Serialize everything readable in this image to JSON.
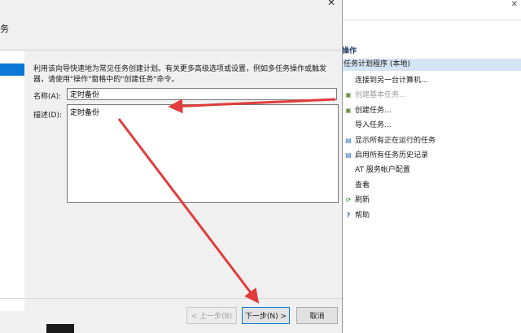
{
  "dialog": {
    "title_partial": "务",
    "close_glyph": "✕",
    "intro_line1": "利用该向导快速地为常见任务创建计划。有关更多高级选项或设置，例如多任务操作或触发",
    "intro_line2": "器，请使用\"操作\"窗格中的\"创建任务\"命令。",
    "name_label": "名称(A):",
    "name_value": "定时备份",
    "desc_label": "描述(D):",
    "desc_value": "定时备份",
    "buttons": {
      "back": "< 上一步(B)",
      "next": "下一步(N) >",
      "cancel": "取消"
    }
  },
  "actions_pane": {
    "close_glyph": "✕",
    "header": "操作",
    "section": "任务计划程序 (本地)",
    "items": [
      {
        "label": "连接到另一台计算机...",
        "icon": "none",
        "enabled": true
      },
      {
        "label": "创建基本任务...",
        "icon": "task-icon",
        "enabled": false
      },
      {
        "label": "创建任务...",
        "icon": "task-icon",
        "enabled": true
      },
      {
        "label": "导入任务...",
        "icon": "none",
        "enabled": true
      },
      {
        "label": "显示所有正在运行的任务",
        "icon": "list-icon",
        "enabled": true
      },
      {
        "label": "启用所有任务历史记录",
        "icon": "list-icon",
        "enabled": true
      },
      {
        "label": "AT 服务帐户配置",
        "icon": "none",
        "enabled": true
      },
      {
        "label": "查看",
        "icon": "none",
        "enabled": true
      },
      {
        "label": "刷新",
        "icon": "refresh-icon",
        "enabled": true
      },
      {
        "label": "帮助",
        "icon": "help-icon",
        "enabled": true
      }
    ]
  },
  "colors": {
    "selection": "#0a78d4",
    "section_bg": "#d5e4f4",
    "annotation_arrow": "#e03c3c"
  }
}
